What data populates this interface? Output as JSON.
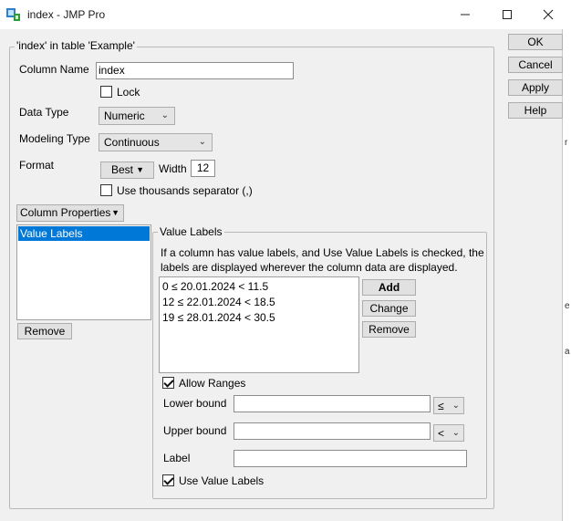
{
  "window": {
    "title": "index - JMP Pro",
    "controls": {
      "minimize": "minimize-icon",
      "maximize": "maximize-icon",
      "close": "close-icon"
    }
  },
  "column_group": {
    "legend": "'index' in table 'Example'"
  },
  "column_name": {
    "label": "Column Name",
    "value": "index"
  },
  "lock": {
    "label": "Lock",
    "checked": false
  },
  "data_type": {
    "label": "Data Type",
    "value": "Numeric"
  },
  "modeling_type": {
    "label": "Modeling Type",
    "value": "Continuous"
  },
  "format": {
    "label": "Format",
    "value": "Best",
    "width_label": "Width",
    "width_value": "12"
  },
  "thousands": {
    "label": "Use thousands separator (,)",
    "checked": false
  },
  "column_properties": {
    "button_label": "Column Properties",
    "items": [
      "Value Labels"
    ],
    "selected_index": 0,
    "remove_label": "Remove"
  },
  "value_labels": {
    "legend": "Value Labels",
    "description_line1": "If a column has value labels, and Use Value Labels is checked, the",
    "description_line2": "labels are displayed wherever the column data are displayed.",
    "entries": [
      "0 ≤ 20.01.2024 < 11.5",
      "12 ≤ 22.01.2024 < 18.5",
      "19 ≤ 28.01.2024 < 30.5"
    ],
    "add_label": "Add",
    "change_label": "Change",
    "remove_label": "Remove",
    "allow_ranges_label": "Allow Ranges",
    "allow_ranges_checked": true,
    "lower_bound_label": "Lower bound",
    "lower_bound_value": "",
    "lower_op": "≤",
    "upper_bound_label": "Upper bound",
    "upper_bound_value": "",
    "upper_op": "<",
    "label_label": "Label",
    "label_value": "",
    "use_value_labels_label": "Use Value Labels",
    "use_value_labels_checked": true
  },
  "actions": {
    "ok": "OK",
    "cancel": "Cancel",
    "apply": "Apply",
    "help": "Help"
  },
  "edge_marks": [
    "r",
    "e",
    "a"
  ]
}
